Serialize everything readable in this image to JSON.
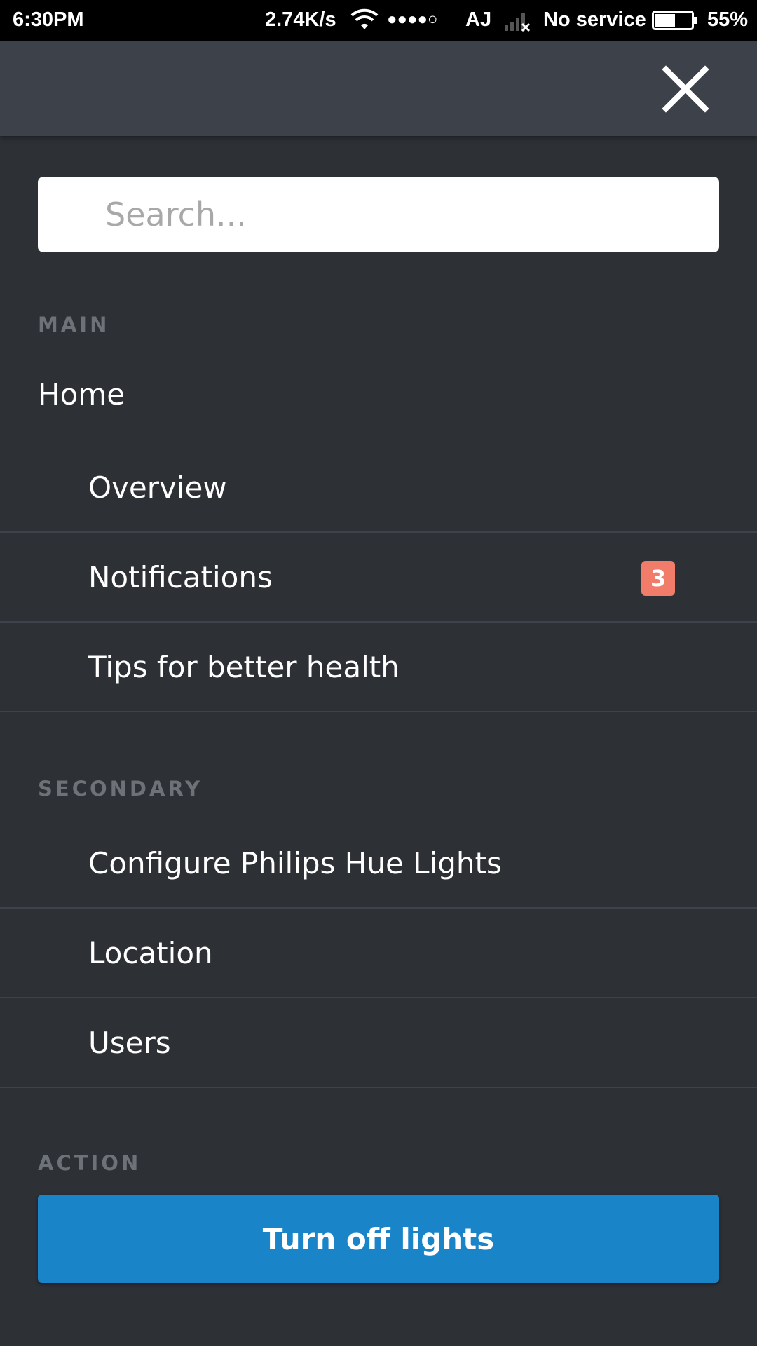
{
  "status_bar": {
    "time": "6:30PM",
    "net_speed": "2.74K/s",
    "signal_dots": "●●●●○",
    "carrier": "AJ",
    "service": "No service",
    "battery_pct": "55%",
    "battery_level": 0.55
  },
  "header": {
    "close_icon": "close-icon"
  },
  "search": {
    "placeholder": "Search...",
    "value": ""
  },
  "sections": {
    "main": {
      "label": "MAIN",
      "home_label": "Home",
      "items": [
        {
          "label": "Overview"
        },
        {
          "label": "Notifications",
          "badge": "3"
        },
        {
          "label": "Tips for better health"
        }
      ]
    },
    "secondary": {
      "label": "SECONDARY",
      "items": [
        {
          "label": "Configure Philips Hue Lights"
        },
        {
          "label": "Location"
        },
        {
          "label": "Users"
        }
      ]
    },
    "action": {
      "label": "ACTION",
      "button_label": "Turn off lights"
    }
  },
  "colors": {
    "background": "#2d3035",
    "header": "#3d4149",
    "badge": "#f07c69",
    "action_button": "#1985c8"
  }
}
